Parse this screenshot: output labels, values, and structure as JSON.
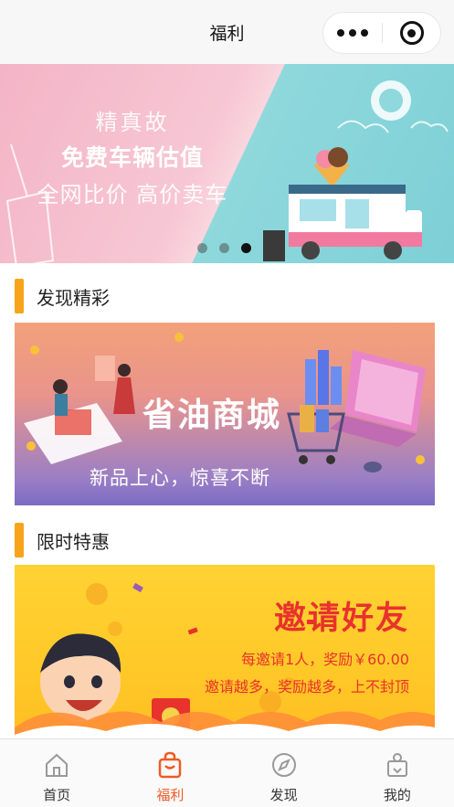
{
  "navbar": {
    "title": "福利"
  },
  "banner": {
    "line1": "精真故",
    "line2": "免费车辆估值",
    "line3": "全网比价 高价卖车",
    "slides": 3,
    "active_index": 2
  },
  "section_discover": {
    "title": "发现精彩"
  },
  "card_mall": {
    "title": "省油商城",
    "subtitle": "新品上心，惊喜不断"
  },
  "section_deals": {
    "title": "限时特惠"
  },
  "card_invite": {
    "title": "邀请好友",
    "line1": "每邀请1人，奖励￥60.00",
    "line2": "邀请越多，奖励越多，上不封顶"
  },
  "tabbar": {
    "items": [
      {
        "label": "首页",
        "icon": "home-icon"
      },
      {
        "label": "福利",
        "icon": "gift-bag-icon"
      },
      {
        "label": "发现",
        "icon": "compass-icon"
      },
      {
        "label": "我的",
        "icon": "user-icon"
      }
    ],
    "active_index": 1
  },
  "colors": {
    "accent": "#f05a24",
    "section_bar": "#f7a41a",
    "invite_red": "#e8322d"
  }
}
